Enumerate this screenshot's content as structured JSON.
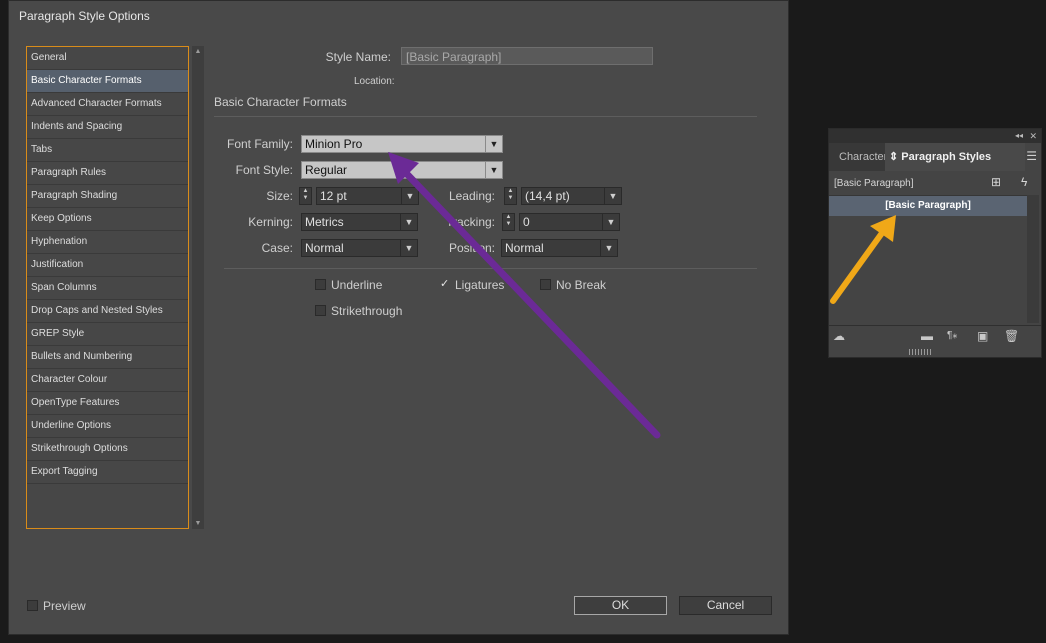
{
  "dialog": {
    "title": "Paragraph Style Options",
    "categories": [
      {
        "label": "General",
        "selected": false
      },
      {
        "label": "Basic Character Formats",
        "selected": true
      },
      {
        "label": "Advanced Character Formats",
        "selected": false
      },
      {
        "label": "Indents and Spacing",
        "selected": false
      },
      {
        "label": "Tabs",
        "selected": false
      },
      {
        "label": "Paragraph Rules",
        "selected": false
      },
      {
        "label": "Paragraph Shading",
        "selected": false
      },
      {
        "label": "Keep Options",
        "selected": false
      },
      {
        "label": "Hyphenation",
        "selected": false
      },
      {
        "label": "Justification",
        "selected": false
      },
      {
        "label": "Span Columns",
        "selected": false
      },
      {
        "label": "Drop Caps and Nested Styles",
        "selected": false
      },
      {
        "label": "GREP Style",
        "selected": false
      },
      {
        "label": "Bullets and Numbering",
        "selected": false
      },
      {
        "label": "Character Colour",
        "selected": false
      },
      {
        "label": "OpenType Features",
        "selected": false
      },
      {
        "label": "Underline Options",
        "selected": false
      },
      {
        "label": "Strikethrough Options",
        "selected": false
      },
      {
        "label": "Export Tagging",
        "selected": false
      }
    ],
    "style_name_label": "Style Name:",
    "style_name_value": "[Basic Paragraph]",
    "location_label": "Location:",
    "section_title": "Basic Character Formats",
    "font_family_label": "Font Family:",
    "font_family_value": "Minion Pro",
    "font_style_label": "Font Style:",
    "font_style_value": "Regular",
    "size_label": "Size:",
    "size_value": "12 pt",
    "leading_label": "Leading:",
    "leading_value": "(14,4 pt)",
    "kerning_label": "Kerning:",
    "kerning_value": "Metrics",
    "tracking_label": "Tracking:",
    "tracking_value": "0",
    "case_label": "Case:",
    "case_value": "Normal",
    "position_label": "Position:",
    "position_value": "Normal",
    "underline_label": "Underline",
    "underline_checked": false,
    "ligatures_label": "Ligatures",
    "ligatures_checked": true,
    "nobreak_label": "No Break",
    "nobreak_checked": false,
    "strikethrough_label": "Strikethrough",
    "strikethrough_checked": false,
    "preview_label": "Preview",
    "preview_checked": false,
    "ok_label": "OK",
    "cancel_label": "Cancel"
  },
  "panel": {
    "tab_character": "Character Styl",
    "tab_paragraph": "Paragraph Styles",
    "current_style": "[Basic Paragraph]",
    "styles": [
      "[Basic Paragraph]"
    ]
  },
  "annotations": {
    "purple_arrow_color": "#6b2a96",
    "orange_arrow_color": "#f0a818"
  },
  "icons": {
    "collapse": "double-chevron-left-icon",
    "close": "close-icon",
    "panel_menu": "hamburger-menu-icon",
    "new_from_selection": "new-style-plus-icon",
    "lightning": "lightning-icon",
    "cloud": "cloud-library-icon",
    "folder": "folder-icon",
    "clear_overrides": "clear-overrides-icon",
    "new_style": "new-style-icon",
    "delete": "trash-icon"
  }
}
